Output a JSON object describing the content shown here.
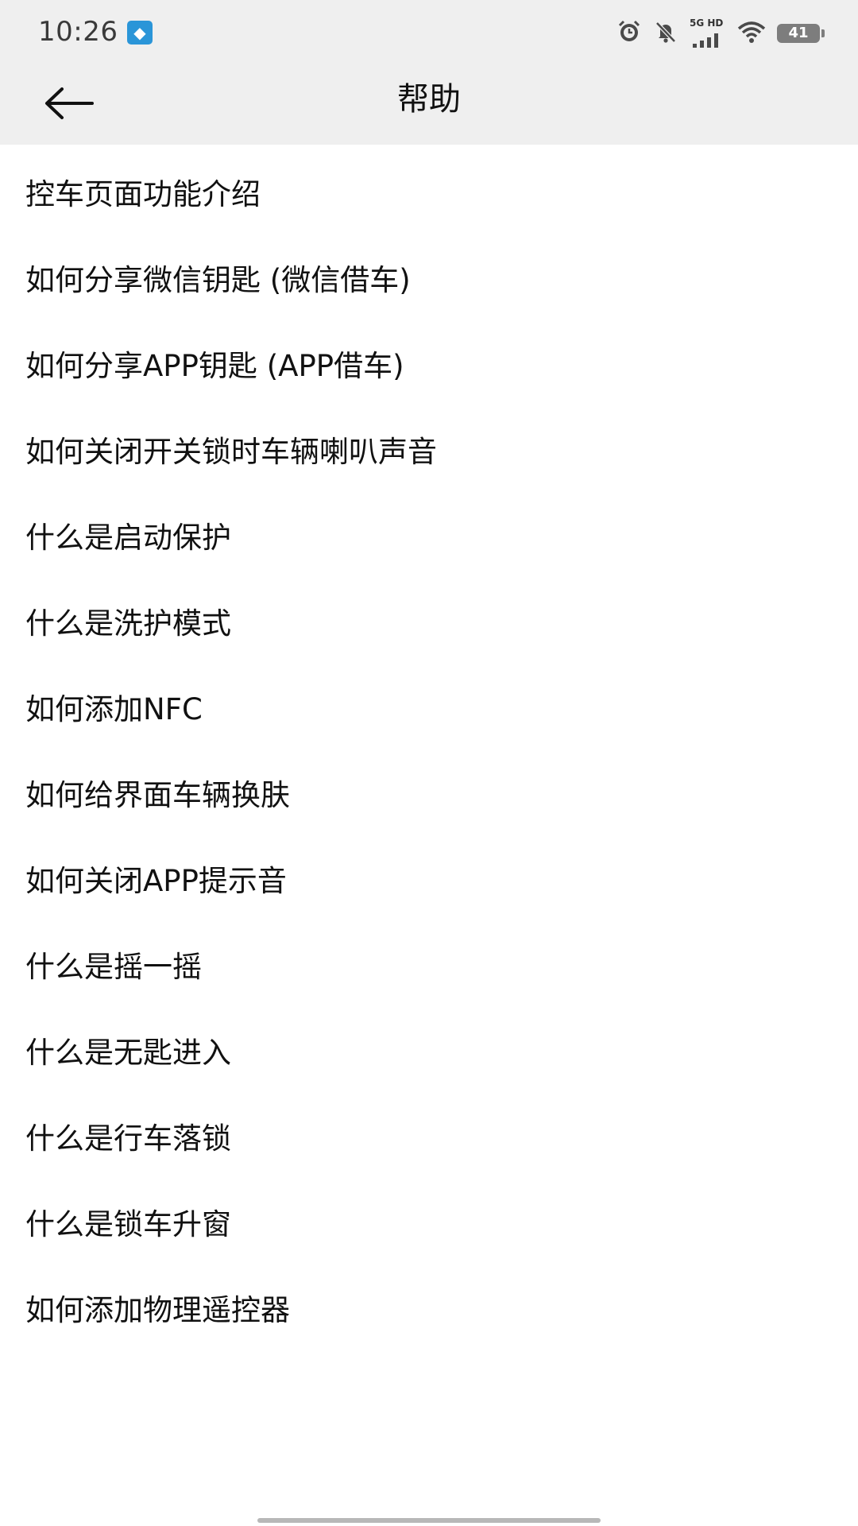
{
  "status_bar": {
    "time": "10:26",
    "app_notification_icon": "app-notification-icon",
    "network_label": "5G HD",
    "battery_level": "41",
    "icons": [
      "alarm-icon",
      "bell-muted-icon",
      "signal-icon",
      "wifi-icon",
      "battery-icon"
    ]
  },
  "header": {
    "title": "帮助",
    "back_icon": "arrow-left-icon"
  },
  "help_items": [
    {
      "label": "控车页面功能介绍"
    },
    {
      "label": "如何分享微信钥匙 (微信借车)"
    },
    {
      "label": "如何分享APP钥匙 (APP借车)"
    },
    {
      "label": "如何关闭开关锁时车辆喇叭声音"
    },
    {
      "label": "什么是启动保护"
    },
    {
      "label": "什么是洗护模式"
    },
    {
      "label": "如何添加NFC"
    },
    {
      "label": "如何给界面车辆换肤"
    },
    {
      "label": "如何关闭APP提示音"
    },
    {
      "label": "什么是摇一摇"
    },
    {
      "label": "什么是无匙进入"
    },
    {
      "label": "什么是行车落锁"
    },
    {
      "label": "什么是锁车升窗"
    },
    {
      "label": "如何添加物理遥控器"
    }
  ],
  "colors": {
    "header_background": "#efefef",
    "page_background": "#ffffff",
    "text": "#111111"
  }
}
